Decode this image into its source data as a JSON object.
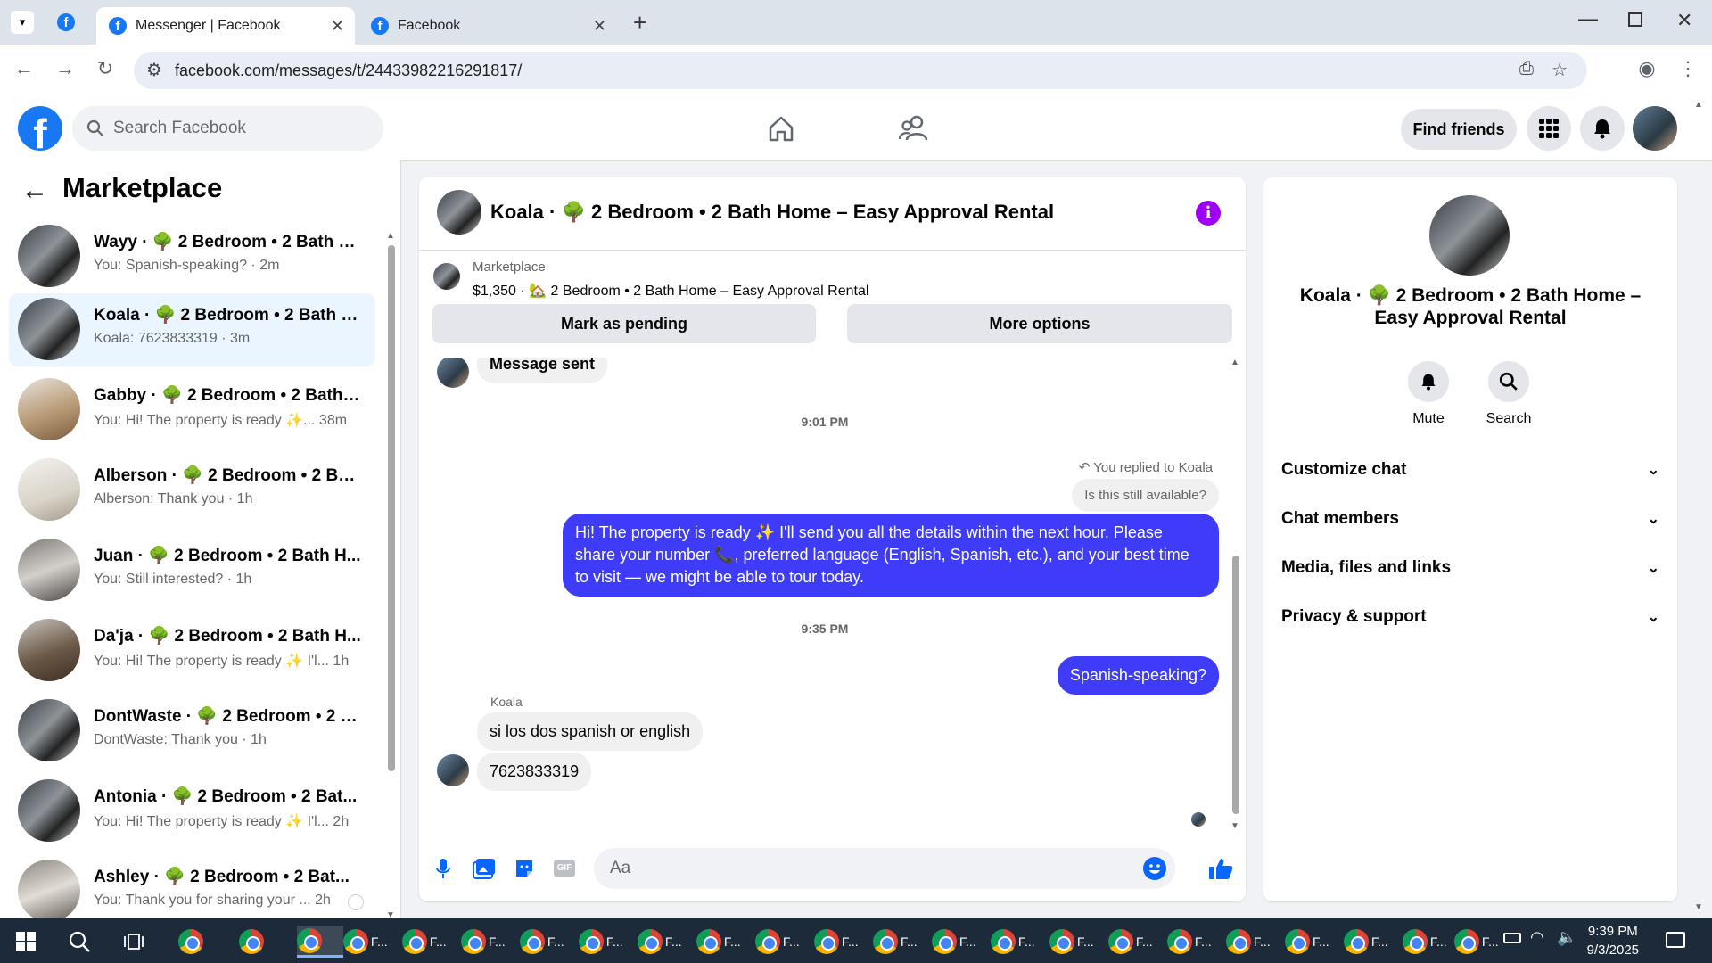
{
  "browser": {
    "tabs": [
      {
        "title": "Messenger | Facebook",
        "active": true
      },
      {
        "title": "Facebook",
        "active": false
      }
    ],
    "url": "facebook.com/messages/t/24433982216291817/"
  },
  "topbar": {
    "search_placeholder": "Search Facebook",
    "find_friends": "Find friends"
  },
  "sidebar": {
    "title": "Marketplace",
    "conversations": [
      {
        "name": "Wayy · 🌳 2 Bedroom • 2 Bath H...",
        "preview": "You: Spanish-speaking? · 2m",
        "active": false
      },
      {
        "name": "Koala · 🌳 2 Bedroom • 2 Bath H...",
        "preview": "Koala: 7623833319 · 3m",
        "active": true
      },
      {
        "name": "Gabby · 🌳 2 Bedroom • 2 Bath ...",
        "preview": "You: Hi! The property is ready ✨... 38m",
        "active": false
      },
      {
        "name": "Alberson · 🌳 2 Bedroom • 2 Bat...",
        "preview": "Alberson: Thank you · 1h",
        "active": false
      },
      {
        "name": "Juan · 🌳 2 Bedroom • 2 Bath H...",
        "preview": "You: Still interested? · 1h",
        "active": false
      },
      {
        "name": "Da'ja · 🌳 2 Bedroom • 2 Bath H...",
        "preview": "You: Hi! The property is ready ✨ I'l... 1h",
        "active": false
      },
      {
        "name": "DontWaste · 🌳 2 Bedroom • 2 B...",
        "preview": "DontWaste: Thank you · 1h",
        "active": false
      },
      {
        "name": "Antonia · 🌳 2 Bedroom • 2 Bat...",
        "preview": "You: Hi! The property is ready ✨ I'l... 2h",
        "active": false
      },
      {
        "name": "Ashley · 🌳 2 Bedroom • 2 Bat...",
        "preview": "You: Thank you for sharing your ... 2h",
        "active": false
      }
    ]
  },
  "chat": {
    "title": "Koala · 🌳 2 Bedroom • 2 Bath Home – Easy Approval Rental",
    "listing_source": "Marketplace",
    "listing_detail": "$1,350 · 🏡 2 Bedroom • 2 Bath Home – Easy Approval Rental",
    "mark_pending": "Mark as pending",
    "more_options": "More options",
    "messages": {
      "sent_status": "Message sent",
      "time1": "9:01 PM",
      "replied_to": "You replied to Koala",
      "quoted": "Is this still available?",
      "long_reply": "Hi! The property is ready ✨ I'll send you all the details within the next hour. Please share your number 📞, preferred language (English, Spanish, etc.), and your best time to visit — we might be able to tour today.",
      "time2": "9:35 PM",
      "spanish": "Spanish-speaking?",
      "sender": "Koala",
      "reply1": "si los dos spanish or english",
      "reply2": "7623833319"
    },
    "input_placeholder": "Aa"
  },
  "details": {
    "title": "Koala · 🌳 2 Bedroom • 2 Bath Home – Easy Approval Rental",
    "mute": "Mute",
    "search": "Search",
    "rows": [
      "Customize chat",
      "Chat members",
      "Media, files and links",
      "Privacy & support"
    ]
  },
  "taskbar": {
    "app_label": "F...",
    "time": "9:39 PM",
    "date": "9/3/2025"
  }
}
